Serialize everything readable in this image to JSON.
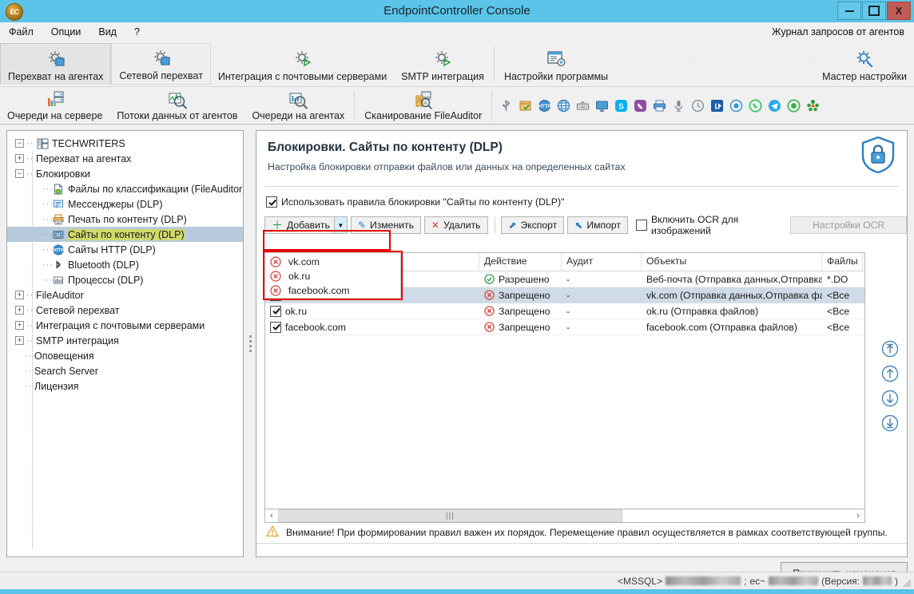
{
  "window": {
    "title": "EndpointController Console",
    "app_icon": "ec-logo-icon",
    "minimize": "—",
    "maximize": "□",
    "close": "X",
    "accent_color": "#5bc4e8",
    "close_color": "#c25b52"
  },
  "menubar": {
    "items": [
      {
        "label": "Файл"
      },
      {
        "label": "Опции"
      },
      {
        "label": "Вид"
      },
      {
        "label": "?"
      }
    ],
    "right_link": "Журнал запросов от агентов"
  },
  "ribbon": {
    "row1": [
      {
        "label": "Перехват на агентах",
        "icon": "gear-monitor-icon",
        "state": "selected"
      },
      {
        "label": "Сетевой перехват",
        "icon": "gear-monitor-icon",
        "state": "hover"
      },
      {
        "label": "Интеграция с почтовыми серверами",
        "icon": "gear-play-icon",
        "state": "normal"
      },
      {
        "label": "SMTP интеграция",
        "icon": "gear-play-icon",
        "state": "normal"
      },
      {
        "label": "Настройки программы",
        "icon": "window-gear-icon",
        "state": "normal"
      },
      {
        "label": "Мастер настройки",
        "icon": "gear-wrench-icon",
        "state": "normal"
      }
    ],
    "row2": [
      {
        "label": "Очереди на сервере",
        "icon": "server-chart-icon"
      },
      {
        "label": "Потоки данных от агентов",
        "icon": "wave-magnifier-icon"
      },
      {
        "label": "Очереди на агентах",
        "icon": "bars-magnifier-icon"
      },
      {
        "label": "Сканирование FileAuditor",
        "icon": "fileauditor-scan-icon"
      }
    ],
    "quick_icons": [
      {
        "name": "usb-icon",
        "color": "#6b7b8c"
      },
      {
        "name": "clipboard-icon",
        "color": "#e8a33d"
      },
      {
        "name": "http-icon",
        "color": "#2f7fc1"
      },
      {
        "name": "globe-icon",
        "color": "#2f7fc1"
      },
      {
        "name": "keyboard-icon",
        "color": "#777777"
      },
      {
        "name": "monitor-icon",
        "color": "#2f7fc1"
      },
      {
        "name": "skype-icon",
        "color": "#00aff0"
      },
      {
        "name": "viber-icon",
        "color": "#8f4ea0"
      },
      {
        "name": "printer-icon",
        "color": "#4a7fb5"
      },
      {
        "name": "microphone-icon",
        "color": "#6b7b8c"
      },
      {
        "name": "clock-icon",
        "color": "#7b8a99"
      },
      {
        "name": "lync-icon",
        "color": "#1b5ea8"
      },
      {
        "name": "webcam-icon",
        "color": "#3a8fd0"
      },
      {
        "name": "whatsapp-icon",
        "color": "#25d366"
      },
      {
        "name": "telegram-icon",
        "color": "#29a9e9"
      },
      {
        "name": "icq-icon",
        "color": "#37b34a"
      },
      {
        "name": "odnoklassniki-icon",
        "color": "#e8672a"
      }
    ]
  },
  "sidebar": {
    "nodes": [
      {
        "label": "TECHWRITERS",
        "level": 0,
        "expander": "−",
        "icon": "server-group-icon",
        "selected": false
      },
      {
        "label": "Перехват на агентах",
        "level": 1,
        "expander": "+",
        "icon": "none",
        "selected": false
      },
      {
        "label": "Блокировки",
        "level": 1,
        "expander": "−",
        "icon": "none",
        "selected": false
      },
      {
        "label": "Файлы по классификации (FileAuditor)",
        "level": 2,
        "expander": "none",
        "icon": "file-shield-icon",
        "selected": false
      },
      {
        "label": "Мессенджеры (DLP)",
        "level": 2,
        "expander": "none",
        "icon": "chat-icon",
        "selected": false
      },
      {
        "label": "Печать по контенту (DLP)",
        "level": 2,
        "expander": "none",
        "icon": "printer-icon",
        "selected": false
      },
      {
        "label": "Сайты по контенту (DLP)",
        "level": 2,
        "expander": "none",
        "icon": "globe-box-icon",
        "selected": true
      },
      {
        "label": "Сайты HTTP (DLP)",
        "level": 2,
        "expander": "none",
        "icon": "http-icon",
        "selected": false
      },
      {
        "label": "Bluetooth (DLP)",
        "level": 2,
        "expander": "none",
        "icon": "bluetooth-icon",
        "selected": false
      },
      {
        "label": "Процессы (DLP)",
        "level": 2,
        "expander": "none",
        "icon": "bars-icon",
        "selected": false
      },
      {
        "label": "FileAuditor",
        "level": 1,
        "expander": "+",
        "icon": "none",
        "selected": false
      },
      {
        "label": "Сетевой перехват",
        "level": 1,
        "expander": "+",
        "icon": "none",
        "selected": false
      },
      {
        "label": "Интеграция с почтовыми серверами",
        "level": 1,
        "expander": "+",
        "icon": "none",
        "selected": false
      },
      {
        "label": "SMTP интеграция",
        "level": 1,
        "expander": "+",
        "icon": "none",
        "selected": false
      },
      {
        "label": "Оповещения",
        "level": 1,
        "expander": "none",
        "icon": "none",
        "selected": false
      },
      {
        "label": "Search Server",
        "level": 1,
        "expander": "none",
        "icon": "none",
        "selected": false
      },
      {
        "label": "Лицензия",
        "level": 1,
        "expander": "none",
        "icon": "none",
        "selected": false
      }
    ]
  },
  "main": {
    "title": "Блокировки. Сайты по контенту (DLP)",
    "subtitle": "Настройка блокировки отправки файлов или данных на определенных сайтах",
    "shield_icon": "lock-shield-icon",
    "use_rules_checkbox": {
      "label": "Использовать правила блокировки \"Сайты по контенту (DLP)\"",
      "checked": true
    },
    "toolbar": {
      "add_label": "Добавить",
      "add_caret": "▼",
      "edit_label": "Изменить",
      "delete_label": "Удалить",
      "export_label": "Экспорт",
      "import_label": "Импорт",
      "ocr_checkbox_label": "Включить OCR для изображений",
      "ocr_checked": false,
      "ocr_settings_label": "Настройки OCR",
      "ocr_settings_disabled": true
    },
    "add_dropdown": {
      "open": true,
      "items": [
        {
          "label": "vk.com",
          "icon": "deny-circle-icon"
        },
        {
          "label": "ok.ru",
          "icon": "deny-circle-icon"
        },
        {
          "label": "facebook.com",
          "icon": "deny-circle-icon"
        }
      ]
    },
    "grid": {
      "headers": [
        "",
        "Действие",
        "Аудит",
        "Объекты",
        "Файлы"
      ],
      "rows": [
        {
          "name": "",
          "checked": true,
          "action": "Разрешено",
          "action_icon": "allow-check-icon",
          "audit": "-",
          "objects": "Веб-почта (Отправка данных,Отправка файл...",
          "files": "*.DO",
          "selected": false
        },
        {
          "name": "vk.com",
          "checked": true,
          "action": "Запрещено",
          "action_icon": "deny-circle-icon",
          "audit": "-",
          "objects": "vk.com (Отправка данных,Отправка файлов)",
          "files": "<Все",
          "selected": true
        },
        {
          "name": "ok.ru",
          "checked": true,
          "action": "Запрещено",
          "action_icon": "deny-circle-icon",
          "audit": "-",
          "objects": "ok.ru (Отправка файлов)",
          "files": "<Все",
          "selected": false
        },
        {
          "name": "facebook.com",
          "checked": true,
          "action": "Запрещено",
          "action_icon": "deny-circle-icon",
          "audit": "-",
          "objects": "facebook.com (Отправка файлов)",
          "files": "<Все",
          "selected": false
        }
      ],
      "hscroll": {
        "left_arrow": "‹",
        "right_arrow": "›",
        "thumb_glyph": "|||"
      }
    },
    "order_buttons": [
      {
        "name": "move-to-top-button",
        "icon": "arrow-up-bar-icon"
      },
      {
        "name": "move-up-button",
        "icon": "arrow-up-icon"
      },
      {
        "name": "move-down-button",
        "icon": "arrow-down-icon"
      },
      {
        "name": "move-to-bottom-button",
        "icon": "arrow-down-bar-icon"
      }
    ],
    "warning": {
      "icon": "warning-triangle-icon",
      "text": "Внимание! При формировании правил важен их порядок. Перемещение правил осуществляется в рамках соответствующей группы."
    },
    "apply_button": "Применить изменения"
  },
  "statusbar": {
    "db_label": "<MSSQL>",
    "db_value_redacted": true,
    "separator": ";",
    "server_prefix": "ec~",
    "server_value_redacted": true,
    "version_label": "(Версия:",
    "version_close": ")"
  }
}
